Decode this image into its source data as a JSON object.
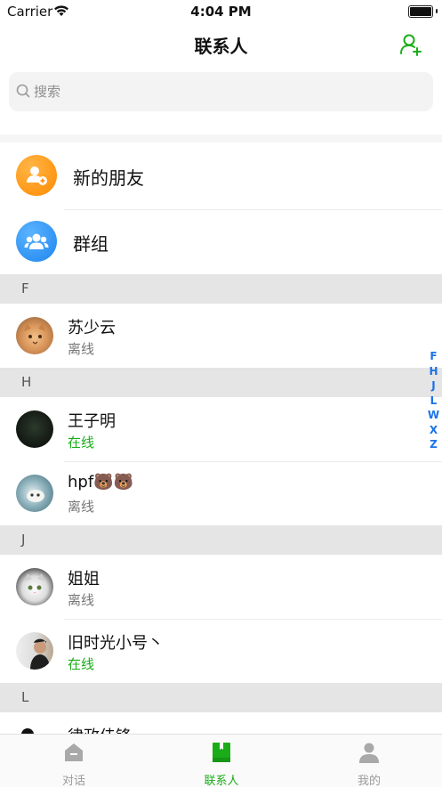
{
  "status_bar": {
    "carrier": "Carrier",
    "time": "4:04 PM"
  },
  "nav": {
    "title": "联系人",
    "add_icon": "add-user-icon"
  },
  "search": {
    "placeholder": "搜索"
  },
  "entries": [
    {
      "label": "新的朋友",
      "icon": "new-friend-icon",
      "color": "#ff8f0c"
    },
    {
      "label": "群组",
      "icon": "group-icon",
      "color": "#2b8ff0"
    }
  ],
  "sections": [
    {
      "letter": "F",
      "contacts": [
        {
          "name": "苏少云",
          "status": "离线"
        }
      ]
    },
    {
      "letter": "H",
      "contacts": [
        {
          "name": "王子明",
          "status": "在线"
        },
        {
          "name": "hpf🐻🐻",
          "status": "离线"
        }
      ]
    },
    {
      "letter": "J",
      "contacts": [
        {
          "name": "姐姐",
          "status": "离线"
        },
        {
          "name": "旧时光小号丶",
          "status": "在线"
        }
      ]
    },
    {
      "letter": "L",
      "contacts": [
        {
          "name": "律政佳锋"
        }
      ]
    }
  ],
  "index": [
    "F",
    "H",
    "J",
    "L",
    "W",
    "X",
    "Z"
  ],
  "tabs": [
    {
      "label": "对话",
      "icon": "chat-icon",
      "active": false
    },
    {
      "label": "联系人",
      "icon": "contacts-icon",
      "active": true
    },
    {
      "label": "我的",
      "icon": "profile-icon",
      "active": false
    }
  ],
  "colors": {
    "accent": "#1aad19",
    "online": "#1aad19",
    "offline": "#777777",
    "index": "#1a73e8",
    "inactive_tab": "#9a9a9a"
  }
}
